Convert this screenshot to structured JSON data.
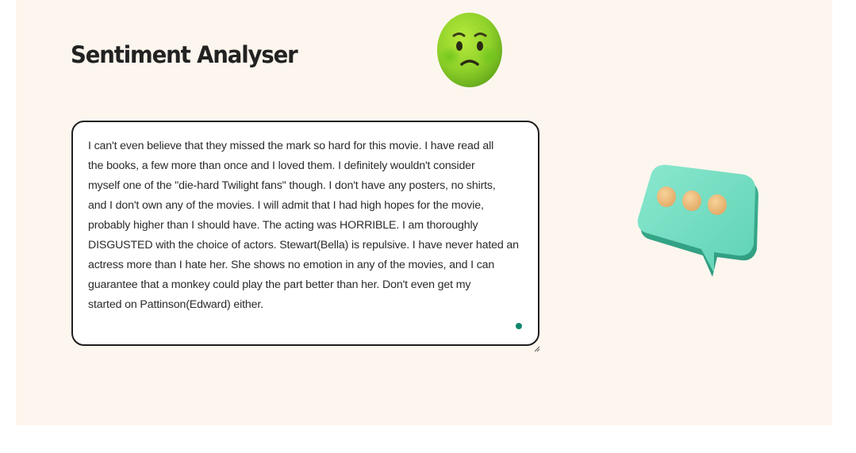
{
  "header": {
    "title": "Sentiment Analyser"
  },
  "sentiment": {
    "emoji_icon": "nauseated-face-icon"
  },
  "review": {
    "lines": [
      "I can't even believe that they missed the mark so hard for this movie. I have read all",
      "the books, a few more than once and I loved them. I definitely wouldn't consider",
      "myself one of the \"die-hard Twilight fans\" though. I don't have any posters, no shirts,",
      "and I don't own any of the movies. I will admit that I had high hopes for the movie,",
      "probably higher than I should have. The acting was HORRIBLE. I am thoroughly",
      "DISGUSTED with the choice of actors. Stewart(Bella) is repulsive. I have never hated an",
      "actress more than I hate her. She shows no emotion in any of the movies, and I can",
      "guarantee that a monkey could play the part better than her. Don't even get my",
      "started on Pattinson(Edward) either."
    ]
  },
  "decoration": {
    "chat_icon": "chat-bubble-icon"
  },
  "colors": {
    "panel_background": "#fdf6ee",
    "status_dot": "#10876d",
    "emoji_green": "#8fd12a",
    "bubble_teal": "#6fdcc0",
    "bubble_dots": "#f0c283"
  }
}
